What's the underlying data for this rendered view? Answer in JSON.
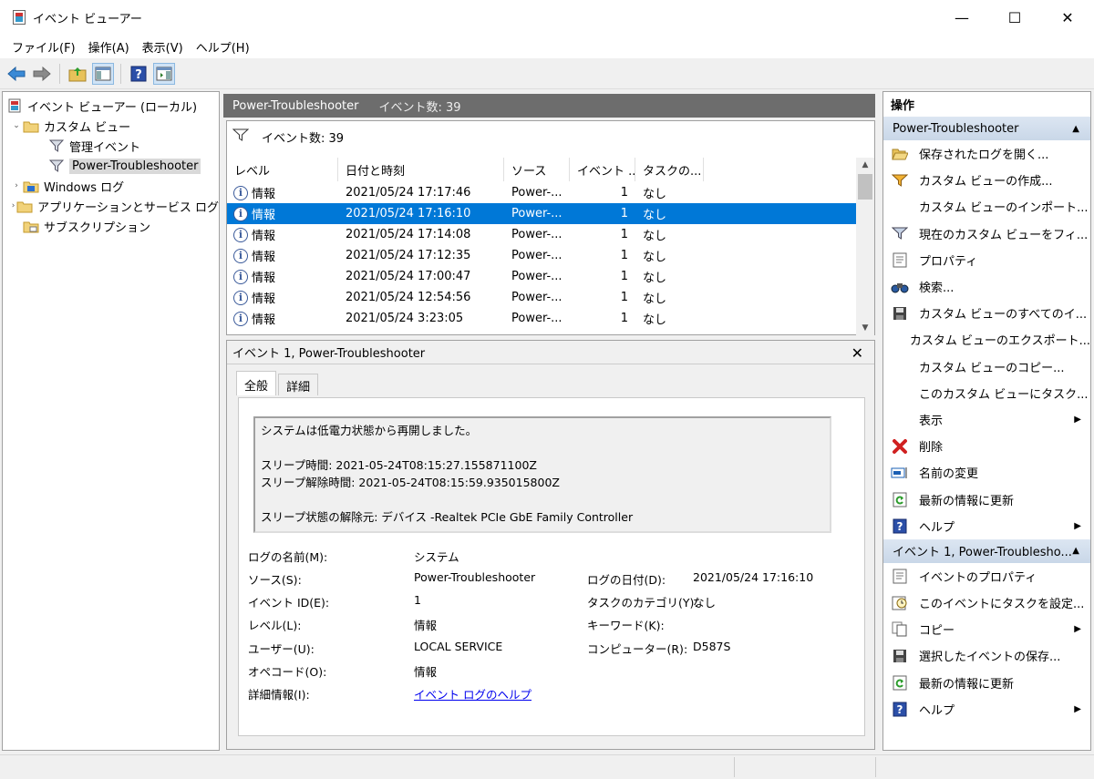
{
  "window": {
    "title": "イベント ビューアー",
    "minimize": "—",
    "maximize": "☐",
    "close": "✕"
  },
  "menu": [
    "ファイル(F)",
    "操作(A)",
    "表示(V)",
    "ヘルプ(H)"
  ],
  "tree": {
    "root": "イベント ビューアー (ローカル)",
    "custom_views": "カスタム ビュー",
    "admin_events": "管理イベント",
    "power_troubleshooter": "Power-Troubleshooter",
    "windows_logs": "Windows ログ",
    "app_service_logs": "アプリケーションとサービス ログ",
    "subscriptions": "サブスクリプション"
  },
  "center": {
    "header_title": "Power-Troubleshooter",
    "header_count": "イベント数: 39",
    "filter_label": "イベント数: 39",
    "columns": [
      "レベル",
      "日付と時刻",
      "ソース",
      "イベント ...",
      "タスクの..."
    ],
    "rows": [
      {
        "level": "情報",
        "date": "2021/05/24 17:17:46",
        "source": "Power-...",
        "id": "1",
        "task": "なし"
      },
      {
        "level": "情報",
        "date": "2021/05/24 17:16:10",
        "source": "Power-...",
        "id": "1",
        "task": "なし"
      },
      {
        "level": "情報",
        "date": "2021/05/24 17:14:08",
        "source": "Power-...",
        "id": "1",
        "task": "なし"
      },
      {
        "level": "情報",
        "date": "2021/05/24 17:12:35",
        "source": "Power-...",
        "id": "1",
        "task": "なし"
      },
      {
        "level": "情報",
        "date": "2021/05/24 17:00:47",
        "source": "Power-...",
        "id": "1",
        "task": "なし"
      },
      {
        "level": "情報",
        "date": "2021/05/24 12:54:56",
        "source": "Power-...",
        "id": "1",
        "task": "なし"
      },
      {
        "level": "情報",
        "date": "2021/05/24 3:23:05",
        "source": "Power-...",
        "id": "1",
        "task": "なし"
      }
    ]
  },
  "detail": {
    "title": "イベント 1, Power-Troubleshooter",
    "tab_general": "全般",
    "tab_details": "詳細",
    "desc_line1": "システムは低電力状態から再開しました。",
    "desc_line2": "スリープ時間: 2021-05-24T08:15:27.155871100Z",
    "desc_line3": "スリープ解除時間: 2021-05-24T08:15:59.935015800Z",
    "desc_line4": "スリープ状態の解除元: デバイス -Realtek PCIe GbE Family Controller",
    "log_name_label": "ログの名前(M):",
    "log_name_value": "システム",
    "source_label": "ソース(S):",
    "source_value": "Power-Troubleshooter",
    "logged_label": "ログの日付(D):",
    "logged_value": "2021/05/24 17:16:10",
    "event_id_label": "イベント ID(E):",
    "event_id_value": "1",
    "task_cat_label": "タスクのカテゴリ(Y):",
    "task_cat_value": "なし",
    "level_label": "レベル(L):",
    "level_value": "情報",
    "keywords_label": "キーワード(K):",
    "user_label": "ユーザー(U):",
    "user_value": "LOCAL SERVICE",
    "computer_label": "コンピューター(R):",
    "computer_value": "D587S",
    "opcode_label": "オペコード(O):",
    "opcode_value": "情報",
    "more_info_label": "詳細情報(I):",
    "more_info_link": "イベント ログのヘルプ"
  },
  "actions": {
    "header": "操作",
    "group1": "Power-Troubleshooter",
    "items1": [
      {
        "label": "保存されたログを開く...",
        "icon": "folder-open-icon"
      },
      {
        "label": "カスタム ビューの作成...",
        "icon": "filter-create-icon"
      },
      {
        "label": "カスタム ビューのインポート...",
        "icon": ""
      },
      {
        "label": "現在のカスタム ビューをフィ...",
        "icon": "filter-icon"
      },
      {
        "label": "プロパティ",
        "icon": "properties-icon"
      },
      {
        "label": "検索...",
        "icon": "binoculars-icon"
      },
      {
        "label": "カスタム ビューのすべてのイ...",
        "icon": "save-icon"
      },
      {
        "label": "カスタム ビューのエクスポート...",
        "icon": ""
      },
      {
        "label": "カスタム ビューのコピー...",
        "icon": ""
      },
      {
        "label": "このカスタム ビューにタスク...",
        "icon": ""
      },
      {
        "label": "表示",
        "icon": "",
        "submenu": true
      },
      {
        "label": "削除",
        "icon": "delete-icon"
      },
      {
        "label": "名前の変更",
        "icon": "rename-icon"
      },
      {
        "label": "最新の情報に更新",
        "icon": "refresh-icon"
      },
      {
        "label": "ヘルプ",
        "icon": "help-icon",
        "submenu": true
      }
    ],
    "group2": "イベント 1, Power-Troublesho...",
    "items2": [
      {
        "label": "イベントのプロパティ",
        "icon": "properties-icon"
      },
      {
        "label": "このイベントにタスクを設定...",
        "icon": "task-icon"
      },
      {
        "label": "コピー",
        "icon": "copy-icon",
        "submenu": true
      },
      {
        "label": "選択したイベントの保存...",
        "icon": "save-icon"
      },
      {
        "label": "最新の情報に更新",
        "icon": "refresh-icon"
      },
      {
        "label": "ヘルプ",
        "icon": "help-icon",
        "submenu": true
      }
    ]
  }
}
